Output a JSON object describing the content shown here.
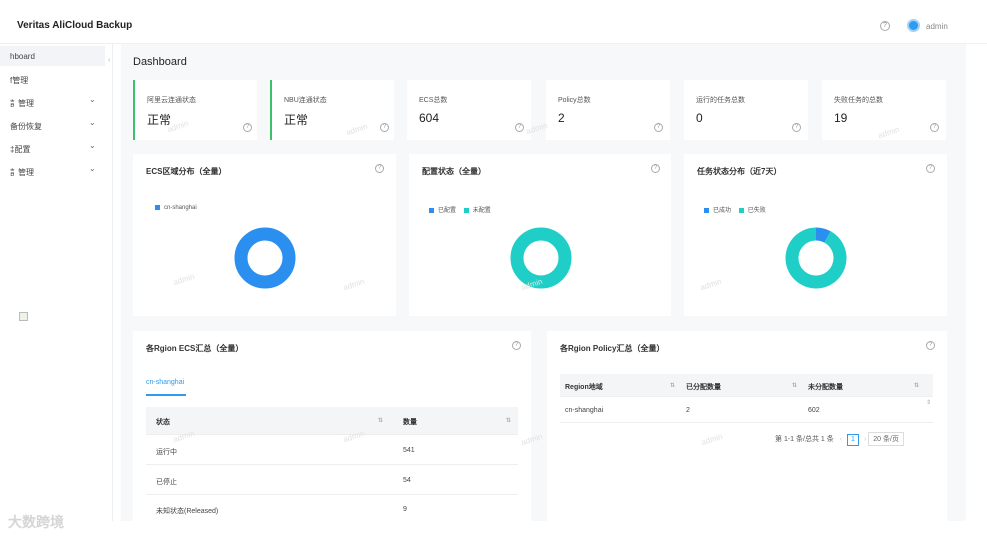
{
  "app": {
    "title": "Veritas AliCloud Backup",
    "user": "admin",
    "help": "?"
  },
  "sidebar": {
    "collapse": "‹",
    "items": [
      {
        "label": "hboard",
        "chevron": ""
      },
      {
        "label": "f管理",
        "chevron": ""
      },
      {
        "label": "訁管理",
        "chevron": "⌄"
      },
      {
        "label": "备份恢复",
        "chevron": "⌄"
      },
      {
        "label": "‡配置",
        "chevron": "⌄"
      },
      {
        "label": "訁管理",
        "chevron": "⌄"
      }
    ]
  },
  "page": {
    "title": "Dashboard"
  },
  "stats": [
    {
      "label": "阿里云连通状态",
      "value": "正常",
      "q": "?"
    },
    {
      "label": "NBU连通状态",
      "value": "正常",
      "q": "?"
    },
    {
      "label": "ECS总数",
      "value": "604",
      "q": "?"
    },
    {
      "label": "Policy总数",
      "value": "2",
      "q": "?"
    },
    {
      "label": "运行的任务总数",
      "value": "0",
      "q": "?"
    },
    {
      "label": "失败任务的总数",
      "value": "19",
      "q": "?"
    }
  ],
  "charts": {
    "ecs_region": {
      "title": "ECS区域分布（全量）",
      "legend": [
        "cn-shanghai"
      ],
      "colors": [
        "#2b8ff0"
      ],
      "values": [
        604
      ]
    },
    "config_status": {
      "title": "配置状态（全量）",
      "legend": [
        "已配置",
        "未配置"
      ],
      "colors": [
        "#2b8ff0",
        "#1fcfc7"
      ],
      "values": [
        0,
        1
      ]
    },
    "task_status": {
      "title": "任务状态分布（近7天）",
      "legend": [
        "已成功",
        "已失败"
      ],
      "colors": [
        "#2b8ff0",
        "#1fcfc7"
      ],
      "values": [
        0.08,
        0.92
      ]
    }
  },
  "ecs_summary": {
    "title": "各Rgion ECS汇总（全量）",
    "tab": "cn-shanghai",
    "columns": [
      "状态",
      "数量"
    ],
    "rows": [
      {
        "status": "运行中",
        "count": "541"
      },
      {
        "status": "已停止",
        "count": "54"
      },
      {
        "status": "未知状态(Released)",
        "count": "9"
      }
    ]
  },
  "policy_summary": {
    "title": "各Rgion Policy汇总（全量）",
    "columns": [
      "Region地域",
      "已分配数量",
      "未分配数量"
    ],
    "rows": [
      {
        "region": "cn-shanghai",
        "assigned": "2",
        "unassigned": "602"
      }
    ],
    "pager": {
      "total": "第 1-1 条/总共 1 条",
      "prev": "‹",
      "current": "1",
      "next": "›",
      "page_size": "20 条/页"
    }
  },
  "watermark": "admin",
  "brand": "大数跨境"
}
